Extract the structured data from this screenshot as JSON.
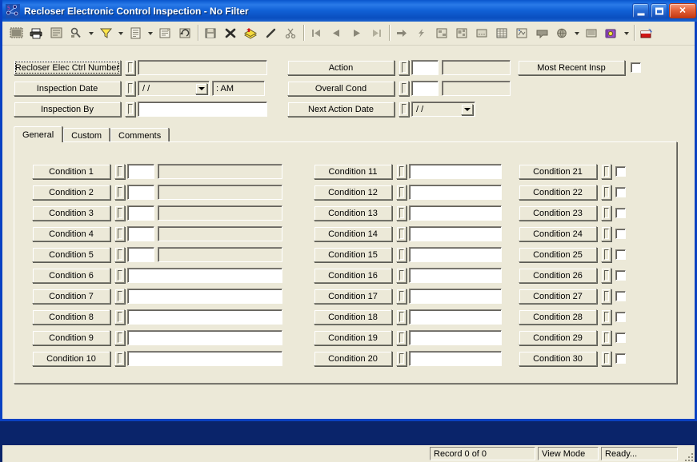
{
  "window": {
    "title": "Recloser Electronic Control Inspection - No Filter",
    "icon": "app-network-icon",
    "buttons": {
      "minimize": "_",
      "maximize": "□",
      "close": "✕"
    }
  },
  "toolbar": {
    "items": [
      {
        "name": "select-all-icon",
        "glyph": "▤"
      },
      {
        "name": "print-icon",
        "glyph": "🖶"
      },
      {
        "name": "print-preview-icon",
        "glyph": "▦"
      },
      {
        "name": "find-icon",
        "glyph": "⚲",
        "split": true
      },
      {
        "name": "filter-icon",
        "glyph": "▽",
        "split": true
      },
      {
        "name": "report-icon",
        "glyph": "▤",
        "split": true
      },
      {
        "name": "properties-icon",
        "glyph": "▣"
      },
      {
        "name": "refresh-icon",
        "glyph": "↻"
      },
      {
        "name": "separator",
        "glyph": ""
      },
      {
        "name": "save-icon",
        "glyph": "▪"
      },
      {
        "name": "delete-icon",
        "glyph": "✗"
      },
      {
        "name": "layers-icon",
        "glyph": "◈"
      },
      {
        "name": "edit-icon",
        "glyph": "╱"
      },
      {
        "name": "cut-icon",
        "glyph": "✂"
      },
      {
        "name": "separator",
        "glyph": ""
      },
      {
        "name": "first-record-icon",
        "glyph": "◀|"
      },
      {
        "name": "previous-record-icon",
        "glyph": "◀"
      },
      {
        "name": "next-record-icon",
        "glyph": "▶"
      },
      {
        "name": "last-record-icon",
        "glyph": "|▶"
      },
      {
        "name": "separator",
        "glyph": ""
      },
      {
        "name": "goto-icon",
        "glyph": "➡"
      },
      {
        "name": "lightning-icon",
        "glyph": "⚡"
      },
      {
        "name": "hierarchy-icon",
        "glyph": "▤"
      },
      {
        "name": "structure-icon",
        "glyph": "▣"
      },
      {
        "name": "grid-icon",
        "glyph": "▭"
      },
      {
        "name": "table-icon",
        "glyph": "▦"
      },
      {
        "name": "map-icon",
        "glyph": "▨"
      },
      {
        "name": "comment-icon",
        "glyph": "▬"
      },
      {
        "name": "globe-icon",
        "glyph": "◕",
        "split": true
      },
      {
        "name": "keyboard-icon",
        "glyph": "▤"
      },
      {
        "name": "book-icon",
        "glyph": "◆",
        "split": true
      },
      {
        "name": "separator",
        "glyph": ""
      },
      {
        "name": "export-icon",
        "glyph": "▰"
      }
    ]
  },
  "header": {
    "left_rows": [
      {
        "label": "Recloser Elec Ctrl Number",
        "focused": true,
        "lookup": "lookup-icon",
        "value": "",
        "type": "gray-text"
      },
      {
        "label": "Inspection Date",
        "focused": false,
        "lookup": "lookup-icon",
        "value": "/  /",
        "time": ":    AM",
        "type": "date"
      },
      {
        "label": "Inspection By",
        "focused": false,
        "lookup": "lookup-icon",
        "value": "",
        "type": "white-text"
      }
    ],
    "mid_rows": [
      {
        "label": "Action",
        "lookup": "lookup-icon",
        "code": "",
        "value": "",
        "type": "code-desc"
      },
      {
        "label": "Overall Cond",
        "lookup": "lookup-icon",
        "code": "",
        "value": "",
        "type": "code-desc"
      },
      {
        "label": "Next Action Date",
        "lookup": "lookup-icon",
        "value": "/  /",
        "type": "date-only"
      }
    ],
    "right": {
      "label": "Most Recent Insp",
      "checkbox_checked": false
    }
  },
  "tabs": [
    {
      "label": "General",
      "active": true
    },
    {
      "label": "Custom",
      "active": false
    },
    {
      "label": "Comments",
      "active": false
    }
  ],
  "conditions": {
    "col1": [
      {
        "label": "Condition 1",
        "style": "code-desc"
      },
      {
        "label": "Condition 2",
        "style": "code-desc"
      },
      {
        "label": "Condition 3",
        "style": "code-desc"
      },
      {
        "label": "Condition 4",
        "style": "code-desc"
      },
      {
        "label": "Condition 5",
        "style": "code-desc"
      },
      {
        "label": "Condition 6",
        "style": "text"
      },
      {
        "label": "Condition 7",
        "style": "text"
      },
      {
        "label": "Condition 8",
        "style": "text"
      },
      {
        "label": "Condition 9",
        "style": "text"
      },
      {
        "label": "Condition 10",
        "style": "text"
      }
    ],
    "col2": [
      {
        "label": "Condition 11",
        "style": "text"
      },
      {
        "label": "Condition 12",
        "style": "text"
      },
      {
        "label": "Condition 13",
        "style": "text"
      },
      {
        "label": "Condition 14",
        "style": "text"
      },
      {
        "label": "Condition 15",
        "style": "text"
      },
      {
        "label": "Condition 16",
        "style": "text"
      },
      {
        "label": "Condition 17",
        "style": "text"
      },
      {
        "label": "Condition 18",
        "style": "text"
      },
      {
        "label": "Condition 19",
        "style": "text"
      },
      {
        "label": "Condition 20",
        "style": "text"
      }
    ],
    "col3": [
      {
        "label": "Condition 21",
        "style": "check"
      },
      {
        "label": "Condition 22",
        "style": "check"
      },
      {
        "label": "Condition 23",
        "style": "check"
      },
      {
        "label": "Condition 24",
        "style": "check"
      },
      {
        "label": "Condition 25",
        "style": "check"
      },
      {
        "label": "Condition 26",
        "style": "check"
      },
      {
        "label": "Condition 27",
        "style": "check"
      },
      {
        "label": "Condition 28",
        "style": "check"
      },
      {
        "label": "Condition 29",
        "style": "check"
      },
      {
        "label": "Condition 30",
        "style": "check"
      }
    ]
  },
  "statusbar": {
    "record": "Record 0 of 0",
    "mode": "View Mode",
    "state": "Ready..."
  },
  "colors": {
    "title_blue": "#0a4fc0",
    "face": "#ece9d8",
    "field_gray": "#ece9d8",
    "field_white": "#ffffff",
    "shadow": "#5c5c54"
  }
}
